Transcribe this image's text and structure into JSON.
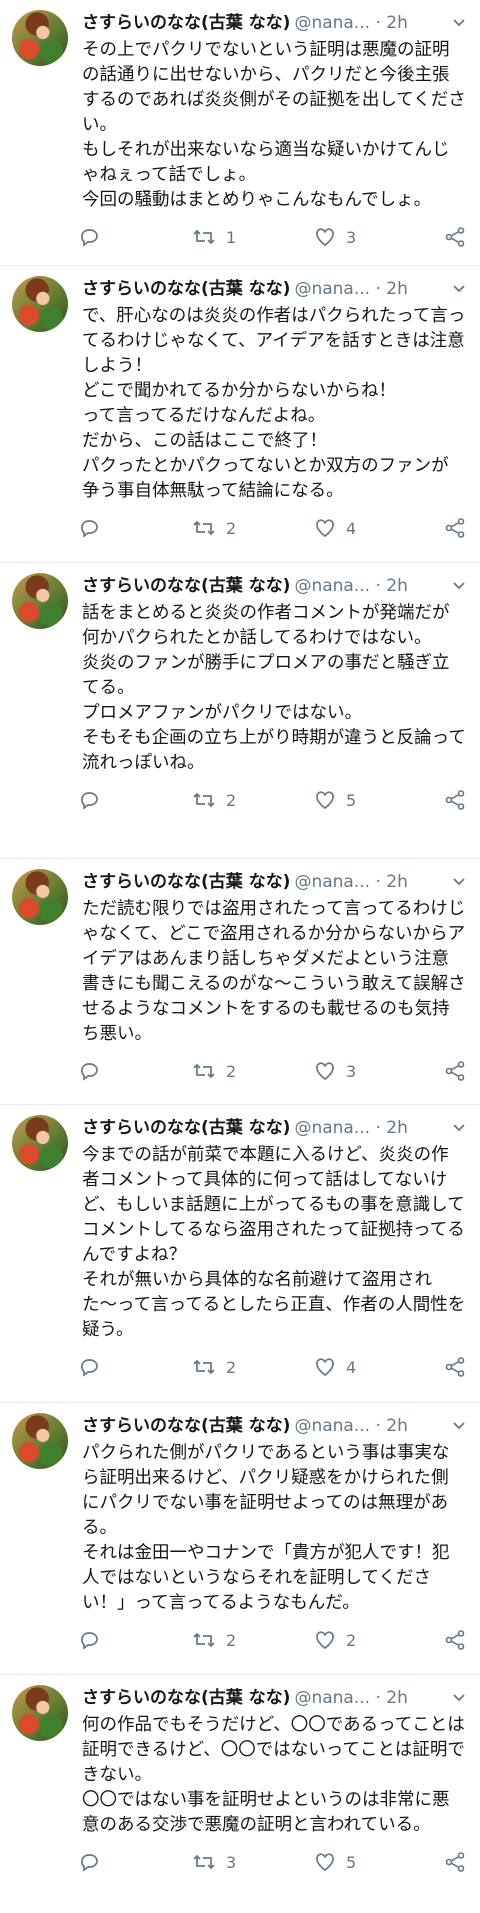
{
  "tweets": [
    {
      "name": "さすらいのなな(古葉 なな)",
      "handle": "@nana...",
      "dot": "·",
      "time": "2h",
      "text": "その上でパクリでないという証明は悪魔の証明の話通りに出せないから、パクリだと今後主張するのであれば炎炎側がその証拠を出してください。\nもしそれが出来ないなら適当な疑いかけてんじゃねぇって話でしょ。\n今回の騒動はまとめりゃこんなもんでしょ。",
      "retweets": "1",
      "likes": "3"
    },
    {
      "name": "さすらいのなな(古葉 なな)",
      "handle": "@nana...",
      "dot": "·",
      "time": "2h",
      "text": "で、肝心なのは炎炎の作者はパクられたって言ってるわけじゃなくて、アイデアを話すときは注意しよう！\nどこで聞かれてるか分からないからね！\nって言ってるだけなんだよね。\nだから、この話はここで終了！\nパクったとかパクってないとか双方のファンが争う事自体無駄って結論になる。",
      "retweets": "2",
      "likes": "4"
    },
    {
      "name": "さすらいのなな(古葉 なな)",
      "handle": "@nana...",
      "dot": "·",
      "time": "2h",
      "text": "話をまとめると炎炎の作者コメントが発端だが何かパクられたとか話してるわけではない。\n炎炎のファンが勝手にプロメアの事だと騒ぎ立てる。\nプロメアファンがパクリではない。\nそもそも企画の立ち上がり時期が違うと反論って流れっぽいね。",
      "retweets": "2",
      "likes": "5"
    },
    {
      "name": "さすらいのなな(古葉 なな)",
      "handle": "@nana...",
      "dot": "·",
      "time": "2h",
      "text": "ただ読む限りでは盗用されたって言ってるわけじゃなくて、どこで盗用されるか分からないからアイデアはあんまり話しちゃダメだよという注意書きにも聞こえるのがな〜こういう敢えて誤解させるようなコメントをするのも載せるのも気持ち悪い。",
      "retweets": "2",
      "likes": "3"
    },
    {
      "name": "さすらいのなな(古葉 なな)",
      "handle": "@nana...",
      "dot": "·",
      "time": "2h",
      "text": "今までの話が前菜で本題に入るけど、炎炎の作者コメントって具体的に何って話はしてないけど、もしいま話題に上がってるもの事を意識してコメントしてるなら盗用されたって証拠持ってるんですよね？\nそれが無いから具体的な名前避けて盗用された〜って言ってるとしたら正直、作者の人間性を疑う。",
      "retweets": "2",
      "likes": "4"
    },
    {
      "name": "さすらいのなな(古葉 なな)",
      "handle": "@nana...",
      "dot": "·",
      "time": "2h",
      "text": "パクられた側がパクリであるという事は事実なら証明出来るけど、パクリ疑惑をかけられた側にパクリでない事を証明せよってのは無理がある。\nそれは金田一やコナンで「貴方が犯人です！犯人ではないというならそれを証明してください！」って言ってるようなもんだ。",
      "retweets": "2",
      "likes": "2"
    },
    {
      "name": "さすらいのなな(古葉 なな)",
      "handle": "@nana...",
      "dot": "·",
      "time": "2h",
      "text": "何の作品でもそうだけど、〇〇であるってことは証明できるけど、〇〇ではないってことは証明できない。\n〇〇ではない事を証明せよというのは非常に悪意のある交渉で悪魔の証明と言われている。",
      "retweets": "3",
      "likes": "5"
    }
  ]
}
